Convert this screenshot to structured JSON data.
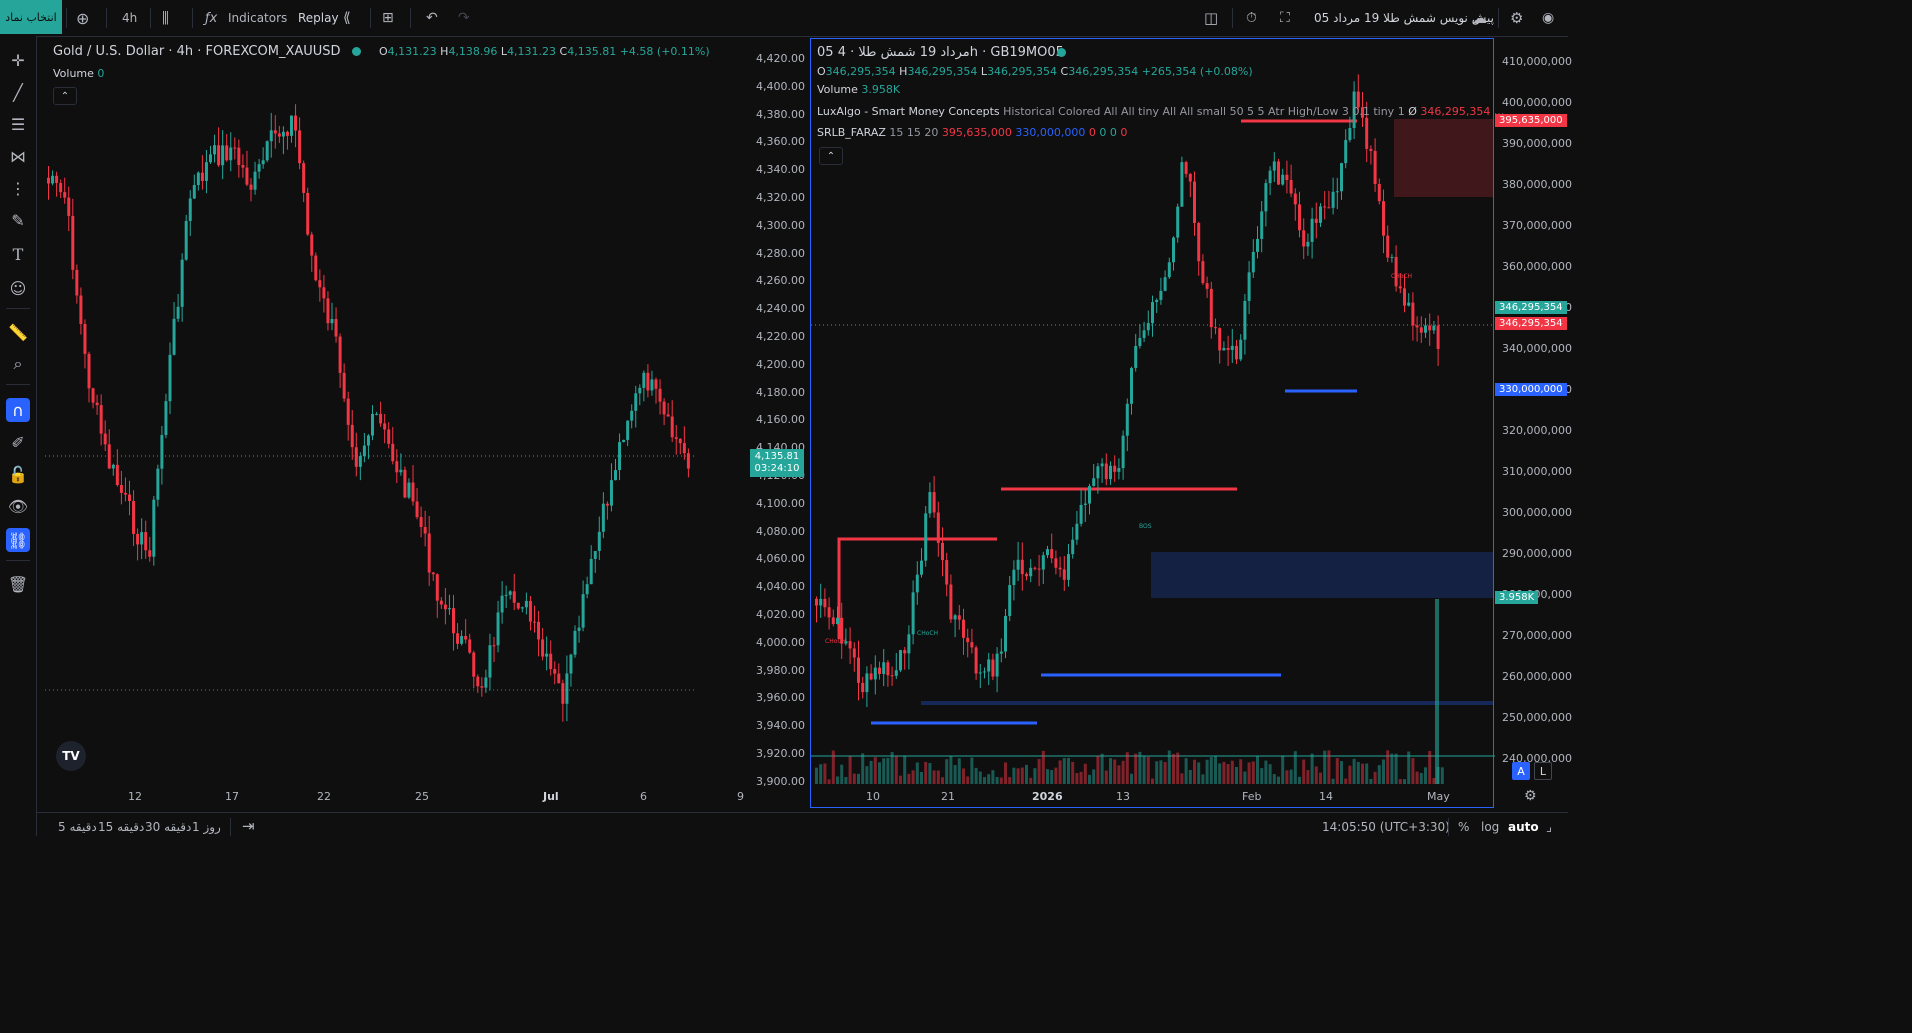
{
  "topbar": {
    "symbol_search": "انتخاب نماد",
    "interval": "4h",
    "indicators": "Indicators",
    "replay": "Replay",
    "right_title": "پیش نویس شمش طلا 19 مرداد 05"
  },
  "left_chart": {
    "title": "Gold / U.S. Dollar · 4h · FOREXCOM_XAUUSD",
    "ohlc": {
      "o_label": "O",
      "o": "4,131.23",
      "h_label": "H",
      "h": "4,138.96",
      "l_label": "L",
      "l": "4,131.23",
      "c_label": "C",
      "c": "4,135.81",
      "chg": "+4.58 (+0.11%)"
    },
    "volume_label": "Volume",
    "volume_value": "0",
    "price_axis": [
      "4,420.00",
      "4,400.00",
      "4,380.00",
      "4,360.00",
      "4,340.00",
      "4,320.00",
      "4,300.00",
      "4,280.00",
      "4,260.00",
      "4,240.00",
      "4,220.00",
      "4,200.00",
      "4,180.00",
      "4,160.00",
      "4,140.00",
      "4,120.00",
      "4,100.00",
      "4,080.00",
      "4,060.00",
      "4,040.00",
      "4,020.00",
      "4,000.00",
      "3,980.00",
      "3,960.00",
      "3,940.00",
      "3,920.00",
      "3,900.00"
    ],
    "time_axis": [
      "12",
      "17",
      "22",
      "25",
      "Jul",
      "6",
      "9"
    ],
    "last_price": "4,135.81",
    "countdown": "03:24:10"
  },
  "right_chart": {
    "title": "05 مرداد 19 شمش طلا · 4h · GB19MO05",
    "ohlc": {
      "o_label": "O",
      "o": "346,295,354",
      "h_label": "H",
      "h": "346,295,354",
      "l_label": "L",
      "l": "346,295,354",
      "c_label": "C",
      "c": "346,295,354",
      "chg": "+265,354 (+0.08%)"
    },
    "volume_label": "Volume",
    "volume_value": "3.958K",
    "indicator1_name": "LuxAlgo - Smart Money Concepts",
    "indicator1_params": "Historical Colored All All tiny All All small 50 5 5 Atr High/Low 3 0.1 tiny 1",
    "indicator1_symbol": "Ø",
    "indicator1_value": "346,295,354",
    "indicator1_more": "...",
    "indicator2_name": "SRLB_FARAZ",
    "indicator2_params": "15 15 20",
    "indicator2_v1": "395,635,000",
    "indicator2_v2": "330,000,000",
    "indicator2_v3": "0",
    "indicator2_v4": "0",
    "indicator2_v5": "0",
    "indicator2_v6": "0",
    "price_axis": [
      "410,000,000",
      "400,000,000",
      "390,000,000",
      "380,000,000",
      "370,000,000",
      "360,000,000",
      "350,000,000",
      "340,000,000",
      "330,000,000",
      "320,000,000",
      "310,000,000",
      "300,000,000",
      "290,000,000",
      "280,000,000",
      "270,000,000",
      "260,000,000",
      "250,000,000",
      "240,000,000"
    ],
    "tag_resistance": "395,635,000",
    "tag_last_green": "346,295,354",
    "tag_last_red": "346,295,354",
    "tag_support": "330,000,000",
    "tag_volume": "3.958K",
    "time_axis": [
      "10",
      "21",
      "2026",
      "13",
      "Feb",
      "14",
      "May"
    ],
    "smc_labels": [
      "CHoCH",
      "CHoCH",
      "BOS",
      "CHoCH"
    ],
    "auto_btn": "A",
    "log_btn": "L"
  },
  "bottombar": {
    "tf_5m": "5 دقیقه",
    "tf_15m": "15 دقیقه",
    "tf_30m": "30 دقیقه",
    "tf_1d": "1 روز",
    "clock": "14:05:50 (UTC+3:30)",
    "pct": "%",
    "log": "log",
    "auto": "auto"
  },
  "colors": {
    "up": "#26a69a",
    "down": "#f23645",
    "accent": "#2962ff",
    "bg": "#0f0f0f"
  }
}
